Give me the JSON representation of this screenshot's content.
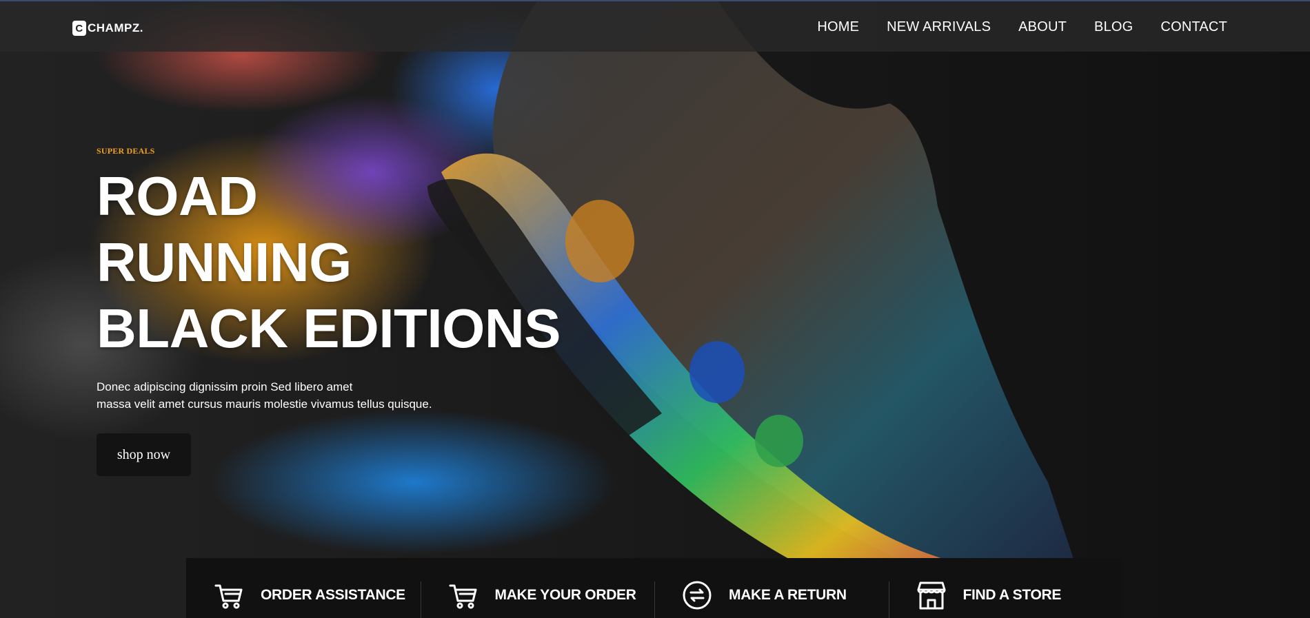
{
  "brand": {
    "logo_mark": "C",
    "name": "CHAMPZ."
  },
  "nav": {
    "items": [
      {
        "label": "HOME"
      },
      {
        "label": "NEW ARRIVALS"
      },
      {
        "label": "ABOUT"
      },
      {
        "label": "BLOG"
      },
      {
        "label": "CONTACT"
      }
    ]
  },
  "hero": {
    "eyebrow": "SUPER DEALS",
    "headline": [
      "ROAD",
      "RUNNING",
      "BLACK EDITIONS"
    ],
    "subtext": [
      "Donec adipiscing dignissim proin Sed libero amet",
      "massa velit amet cursus mauris molestie vivamus tellus quisque."
    ],
    "cta_label": "shop now",
    "accent_color": "#f0a020",
    "image_subject": "colorful running shoe with paint splash"
  },
  "features": [
    {
      "label": "ORDER ASSISTANCE",
      "icon": "cart-icon"
    },
    {
      "label": "MAKE YOUR ORDER",
      "icon": "cart-icon"
    },
    {
      "label": "MAKE A RETURN",
      "icon": "exchange-icon"
    },
    {
      "label": "FIND A STORE",
      "icon": "store-icon"
    }
  ]
}
